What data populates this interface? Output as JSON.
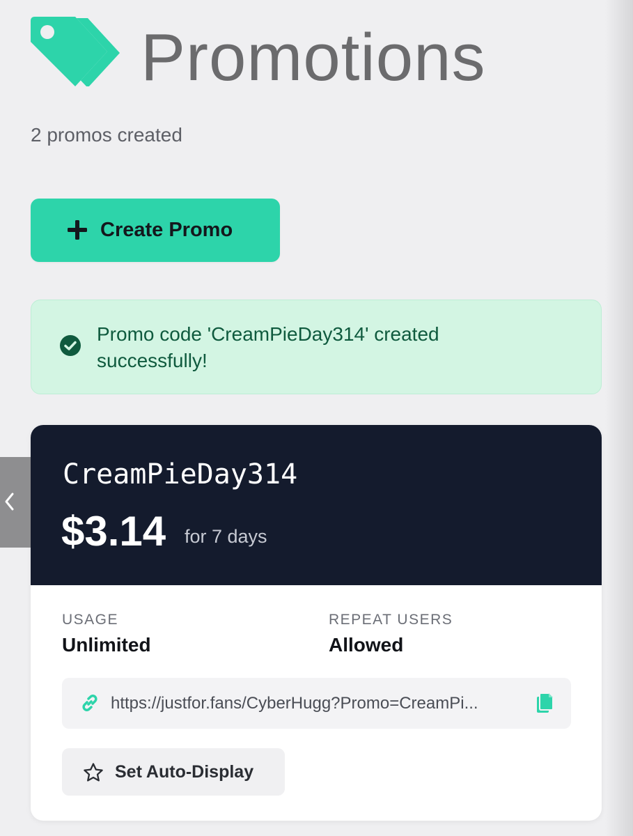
{
  "header": {
    "title": "Promotions",
    "count_text": "2 promos created",
    "logo_icon": "price-tags-icon"
  },
  "colors": {
    "accent": "#2dd4aa",
    "card_header": "#141b2d",
    "success_bg": "#d3f5e3",
    "success_text": "#0f5a3e"
  },
  "actions": {
    "create_label": "Create Promo"
  },
  "alert": {
    "message": "Promo code 'CreamPieDay314' created successfully!"
  },
  "promo": {
    "code": "CreamPieDay314",
    "price": "$3.14",
    "duration": "for 7 days",
    "usage_label": "USAGE",
    "usage_value": "Unlimited",
    "repeat_label": "REPEAT USERS",
    "repeat_value": "Allowed",
    "link": "https://justfor.fans/CyberHugg?Promo=CreamPi...",
    "auto_display_label": "Set Auto-Display"
  }
}
